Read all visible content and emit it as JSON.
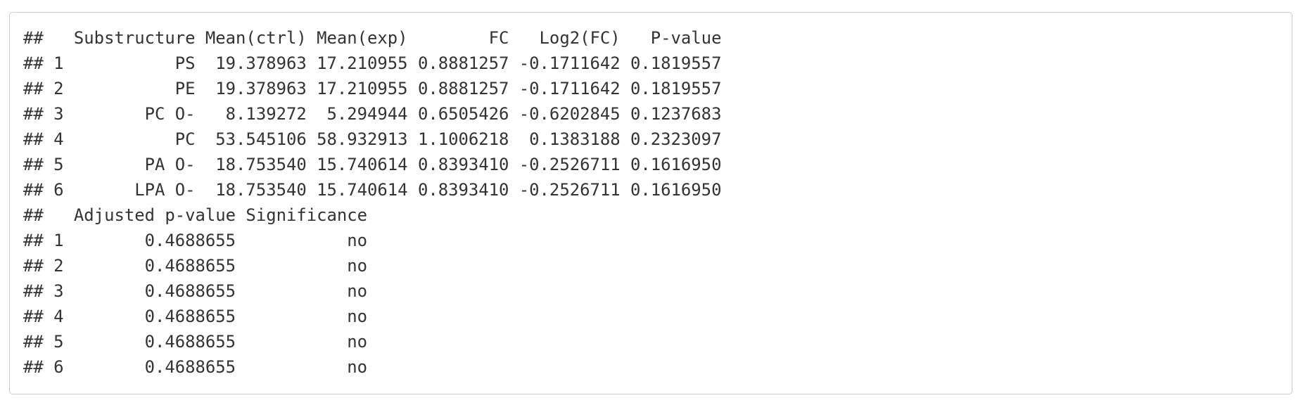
{
  "output": {
    "lines": [
      "##   Substructure Mean(ctrl) Mean(exp)        FC   Log2(FC)   P-value",
      "## 1           PS  19.378963 17.210955 0.8881257 -0.1711642 0.1819557",
      "## 2           PE  19.378963 17.210955 0.8881257 -0.1711642 0.1819557",
      "## 3        PC O-   8.139272  5.294944 0.6505426 -0.6202845 0.1237683",
      "## 4           PC  53.545106 58.932913 1.1006218  0.1383188 0.2323097",
      "## 5        PA O-  18.753540 15.740614 0.8393410 -0.2526711 0.1616950",
      "## 6       LPA O-  18.753540 15.740614 0.8393410 -0.2526711 0.1616950",
      "##   Adjusted p-value Significance",
      "## 1        0.4688655           no",
      "## 2        0.4688655           no",
      "## 3        0.4688655           no",
      "## 4        0.4688655           no",
      "## 5        0.4688655           no",
      "## 6        0.4688655           no"
    ]
  }
}
